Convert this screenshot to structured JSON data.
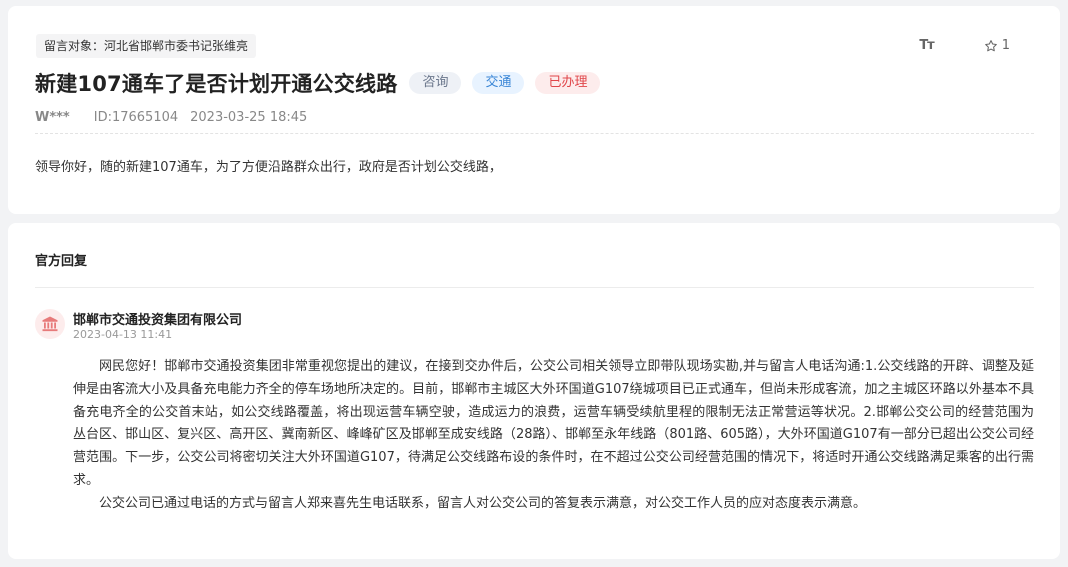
{
  "message": {
    "target": "留言对象：河北省邯郸市委书记张维亮",
    "title": "新建107通车了是否计划开通公交线路",
    "tags": [
      "咨询",
      "交通",
      "已办理"
    ],
    "font_toggle_label": "Tт",
    "favorite_count": "1",
    "author": "W***",
    "id": "ID:17665104",
    "time": "2023-03-25 18:45",
    "content": "领导你好，随的新建107通车，为了方便沿路群众出行，政府是否计划公交线路，"
  },
  "reply": {
    "heading": "官方回复",
    "org_name": "邯郸市交通投资集团有限公司",
    "org_time": "2023-04-13 11:41",
    "paragraphs": [
      "网民您好！邯郸市交通投资集团非常重视您提出的建议，在接到交办件后，公交公司相关领导立即带队现场实勘,并与留言人电话沟通:1.公交线路的开辟、调整及延伸是由客流大小及具备充电能力齐全的停车场地所决定的。目前，邯郸市主城区大外环国道G107绕城项目已正式通车，但尚未形成客流，加之主城区环路以外基本不具备充电齐全的公交首末站，如公交线路覆盖，将出现运营车辆空驶，造成运力的浪费，运营车辆受续航里程的限制无法正常营运等状况。2.邯郸公交公司的经营范围为丛台区、邯山区、复兴区、高开区、冀南新区、峰峰矿区及邯郸至成安线路（28路）、邯郸至永年线路（801路、605路），大外环国道G107有一部分已超出公交公司经营范围。下一步，公交公司将密切关注大外环国道G107，待满足公交线路布设的条件时，在不超过公交公司经营范围的情况下，将适时开通公交线路满足乘客的出行需求。",
      "公交公司已通过电话的方式与留言人郑来喜先生电话联系，留言人对公交公司的答复表示满意，对公交工作人员的应对态度表示满意。"
    ]
  },
  "colors": {
    "accent_red": "#e0464a",
    "accent_blue": "#3a86d6"
  }
}
